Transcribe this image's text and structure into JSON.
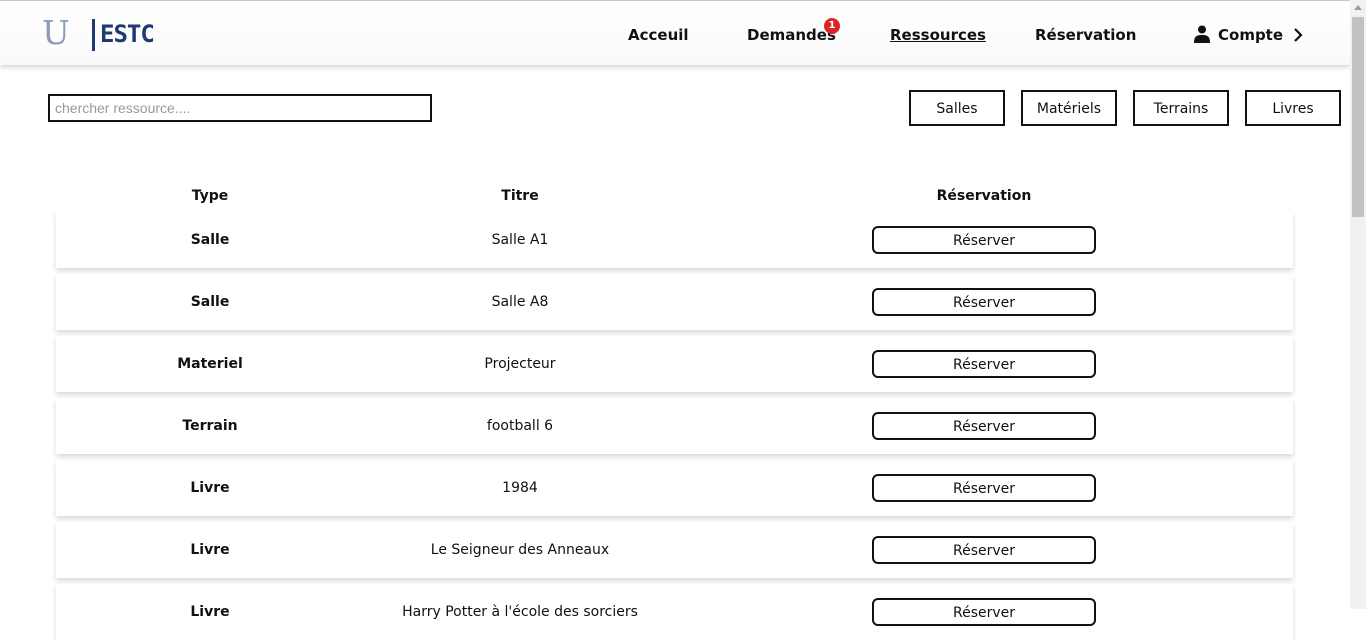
{
  "brand": {
    "logo_mark": "U",
    "logo_text": "ESTC"
  },
  "nav": {
    "links": [
      {
        "label": "Acceuil"
      },
      {
        "label": "Demandes",
        "badge": "1"
      },
      {
        "label": "Ressources"
      },
      {
        "label": "Réservation"
      }
    ],
    "account_label": "Compte"
  },
  "search": {
    "placeholder": "chercher ressource....",
    "value": ""
  },
  "filters": [
    "Salles",
    "Matériels",
    "Terrains",
    "Livres"
  ],
  "table": {
    "headers": {
      "type": "Type",
      "title": "Titre",
      "reservation": "Réservation"
    },
    "rows": [
      {
        "type": "Salle",
        "title": "Salle A1",
        "action": "Réserver"
      },
      {
        "type": "Salle",
        "title": "Salle A8",
        "action": "Réserver"
      },
      {
        "type": "Materiel",
        "title": "Projecteur",
        "action": "Réserver"
      },
      {
        "type": "Terrain",
        "title": "football 6",
        "action": "Réserver"
      },
      {
        "type": "Livre",
        "title": "1984",
        "action": "Réserver"
      },
      {
        "type": "Livre",
        "title": "Le Seigneur des Anneaux",
        "action": "Réserver"
      },
      {
        "type": "Livre",
        "title": "Harry Potter à l'école des sorciers",
        "action": "Réserver"
      }
    ]
  },
  "colors": {
    "badge": "#dc2626",
    "brand": "#1d3a72",
    "logo_mark": "#8a9cb8"
  },
  "icons": {
    "account": "user-icon",
    "chevron": "chevron-right-icon"
  }
}
